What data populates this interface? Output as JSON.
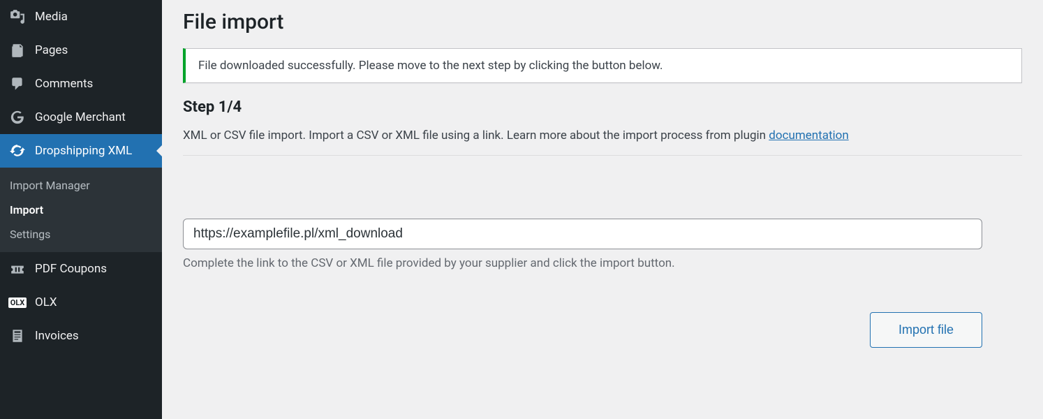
{
  "sidebar": {
    "items": [
      {
        "label": "Media"
      },
      {
        "label": "Pages"
      },
      {
        "label": "Comments"
      },
      {
        "label": "Google Merchant"
      },
      {
        "label": "Dropshipping XML"
      },
      {
        "label": "PDF Coupons"
      },
      {
        "label": "OLX"
      },
      {
        "label": "Invoices"
      }
    ],
    "submenu": [
      {
        "label": "Import Manager"
      },
      {
        "label": "Import"
      },
      {
        "label": "Settings"
      }
    ],
    "olx_badge": "OLX"
  },
  "page": {
    "title": "File import",
    "notice_success": "File downloaded successfully. Please move to the next step by clicking the button below.",
    "step_title": "Step 1/4",
    "step_desc_prefix": "XML or CSV file import. Import a CSV or XML file using a link. Learn more about the import process from plugin ",
    "step_desc_link": "documentation",
    "url_value": "https://examplefile.pl/xml_download",
    "url_help": "Complete the link to the CSV or XML file provided by your supplier and click the import button.",
    "import_button": "Import file"
  }
}
